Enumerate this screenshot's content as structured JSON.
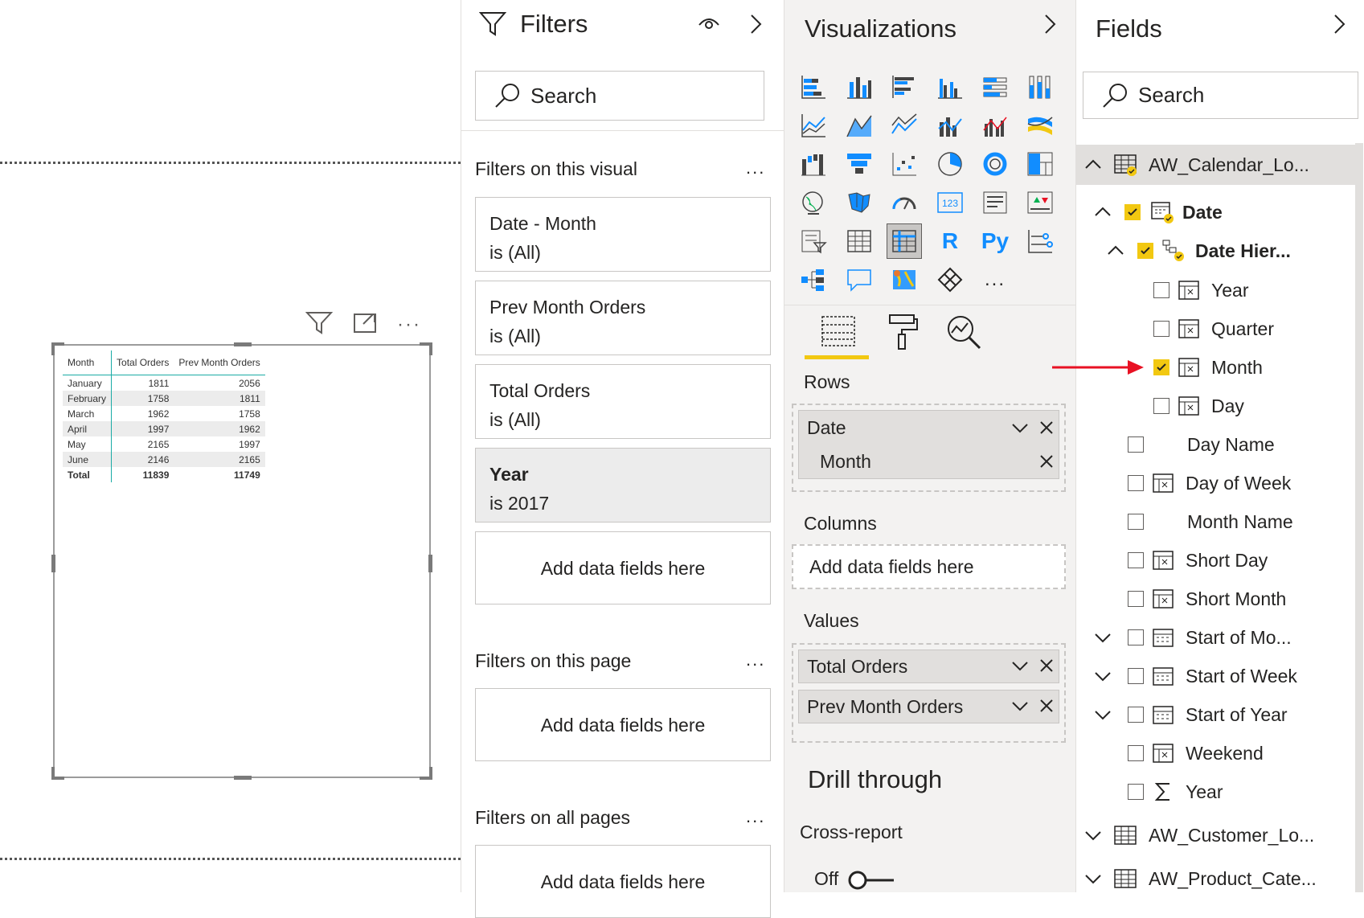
{
  "visual": {
    "columns": [
      "Month",
      "Total Orders",
      "Prev Month Orders"
    ],
    "rows": [
      [
        "January",
        "1811",
        "2056"
      ],
      [
        "February",
        "1758",
        "1811"
      ],
      [
        "March",
        "1962",
        "1758"
      ],
      [
        "April",
        "1997",
        "1962"
      ],
      [
        "May",
        "2165",
        "1997"
      ],
      [
        "June",
        "2146",
        "2165"
      ]
    ],
    "total": [
      "Total",
      "11839",
      "11749"
    ]
  },
  "filters": {
    "title": "Filters",
    "search_placeholder": "Search",
    "on_visual_label": "Filters on this visual",
    "cards": [
      {
        "name": "Date - Month",
        "state": "is (All)"
      },
      {
        "name": "Prev Month Orders",
        "state": "is (All)"
      },
      {
        "name": "Total Orders",
        "state": "is (All)"
      },
      {
        "name": "Year",
        "state": "is 2017"
      }
    ],
    "add_fields": "Add data fields here",
    "on_page_label": "Filters on this page",
    "on_all_label": "Filters on all pages",
    "more": "..."
  },
  "viz": {
    "title": "Visualizations",
    "rows_label": "Rows",
    "rows_pill_group": "Date",
    "rows_pill_item": "Month",
    "columns_label": "Columns",
    "add_fields": "Add data fields here",
    "values_label": "Values",
    "values": [
      "Total Orders",
      "Prev Month Orders"
    ],
    "drill_through": "Drill through",
    "cross_report": "Cross-report",
    "toggle_state": "Off",
    "r_label": "R",
    "py_label": "Py",
    "num_label": "123",
    "more": "..."
  },
  "fields": {
    "title": "Fields",
    "search_placeholder": "Search",
    "table_calendar": "AW_Calendar_Lo...",
    "date": "Date",
    "date_hier": "Date Hier...",
    "hier_items": [
      "Year",
      "Quarter",
      "Month",
      "Day"
    ],
    "items": [
      "Day Name",
      "Day of Week",
      "Month Name",
      "Short Day",
      "Short Month",
      "Start of Mo...",
      "Start of Week",
      "Start of Year",
      "Weekend",
      "Year"
    ],
    "table_customer": "AW_Customer_Lo...",
    "table_product": "AW_Product_Cate..."
  },
  "colors": {
    "accent": "#f2c811",
    "teal": "#1aaba5",
    "arrow": "#e81123"
  }
}
